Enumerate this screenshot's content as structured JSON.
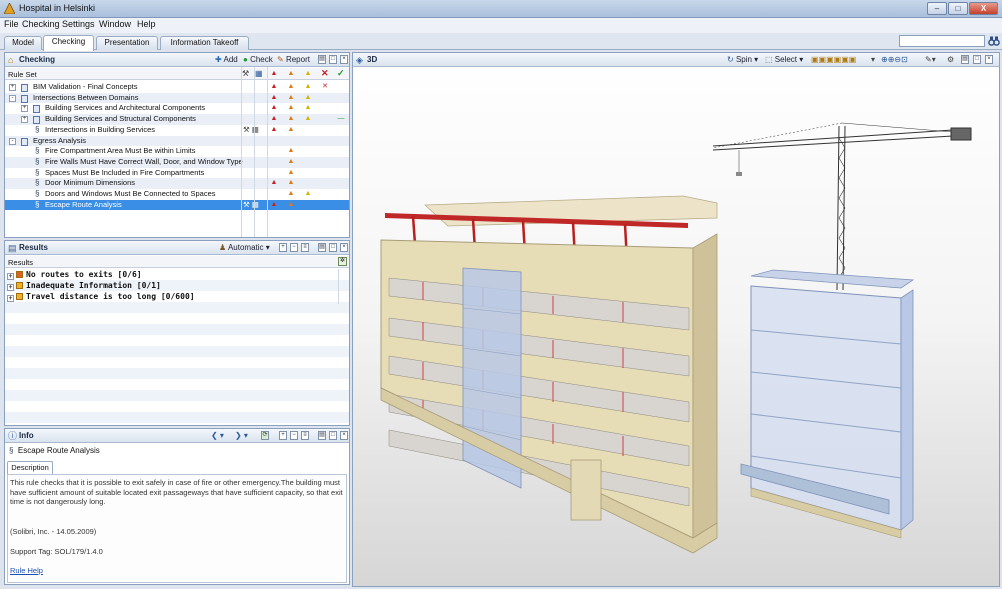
{
  "window": {
    "title": "Hospital in Helsinki",
    "minimize": "–",
    "maximize": "□",
    "close": "X"
  },
  "menu": [
    "File",
    "Checking",
    "Settings",
    "Window",
    "Help"
  ],
  "tabs": [
    {
      "label": "Model",
      "active": false
    },
    {
      "label": "Checking",
      "active": true
    },
    {
      "label": "Presentation",
      "active": false
    },
    {
      "label": "Information Takeoff",
      "active": false
    }
  ],
  "checking": {
    "title": "Checking",
    "add_label": "Add",
    "check_label": "Check",
    "report_label": "Report",
    "column_header": "Rule Set",
    "rows": [
      {
        "label": "BIM Validation - Final Concepts",
        "indent": 0,
        "kind": "ruleset",
        "expand": "+",
        "sev": [
          "red",
          "orange",
          "yellow"
        ],
        "x": true
      },
      {
        "label": "Intersections Between Domains",
        "indent": 0,
        "kind": "ruleset",
        "expand": "-",
        "sev": [
          "red",
          "orange",
          "yellow"
        ],
        "x": false
      },
      {
        "label": "Building Services and Architectural Components",
        "indent": 1,
        "kind": "ruleset",
        "expand": "+",
        "sev": [
          "red",
          "orange",
          "yellow"
        ],
        "x": false
      },
      {
        "label": "Building Services and Structural Components",
        "indent": 1,
        "kind": "ruleset",
        "expand": "+",
        "sev": [
          "red",
          "orange",
          "yellow"
        ],
        "x": false,
        "dash": true
      },
      {
        "label": "Intersections in Building Services",
        "indent": 1,
        "kind": "rule",
        "expand": "",
        "sev": [
          "red",
          "orange"
        ],
        "tools": true
      },
      {
        "label": "Egress Analysis",
        "indent": 0,
        "kind": "ruleset",
        "expand": "-",
        "sev": [],
        "x": false
      },
      {
        "label": "Fire Compartment Area Must Be within Limits",
        "indent": 1,
        "kind": "rule",
        "expand": "",
        "sev": [
          "orange"
        ]
      },
      {
        "label": "Fire Walls Must Have Correct Wall, Door, and Window Type",
        "indent": 1,
        "kind": "rule",
        "expand": "",
        "sev": [
          "orange"
        ]
      },
      {
        "label": "Spaces Must Be Included in Fire Compartments",
        "indent": 1,
        "kind": "rule",
        "expand": "",
        "sev": [
          "orange"
        ]
      },
      {
        "label": "Door Minimum Dimensions",
        "indent": 1,
        "kind": "rule",
        "expand": "",
        "sev": [
          "red",
          "orange"
        ]
      },
      {
        "label": "Doors and Windows Must Be Connected to Spaces",
        "indent": 1,
        "kind": "rule",
        "expand": "",
        "sev": [
          "orange",
          "yellow"
        ]
      },
      {
        "label": "Escape Route Analysis",
        "indent": 1,
        "kind": "rule",
        "expand": "",
        "sev": [
          "red",
          "orange"
        ],
        "selected": true,
        "tools": true
      }
    ]
  },
  "results": {
    "title": "Results",
    "mode_label": "Automatic",
    "column_header": "Results",
    "items": [
      {
        "label": "No routes to exits [0/6]",
        "severity": "red"
      },
      {
        "label": "Inadequate Information [0/1]",
        "severity": "orange"
      },
      {
        "label": "Travel distance is too long [0/600]",
        "severity": "orange"
      }
    ]
  },
  "info": {
    "title": "Info",
    "rule_name": "Escape Route Analysis",
    "tab_label": "Description",
    "description": "This rule checks that it is possible to exit safely in case of fire or other emergency.The building must have sufficient amount of suitable located exit passageways that have sufficient capacity, so that exit time is not dangerously long.",
    "author": "(Solibri, Inc. - 14.05.2009)",
    "support_tag": "Support Tag: SOL/179/1.4.0",
    "help_link": "Rule Help"
  },
  "view3d": {
    "title": "3D",
    "spin_label": "Spin",
    "select_label": "Select"
  },
  "colors": {
    "selection": "#3a8ee6",
    "severity_red": "#c82020",
    "severity_orange": "#e07a10",
    "severity_yellow": "#d2b200",
    "facade": "#e6dcb6",
    "glass": "#b9c8e6"
  }
}
